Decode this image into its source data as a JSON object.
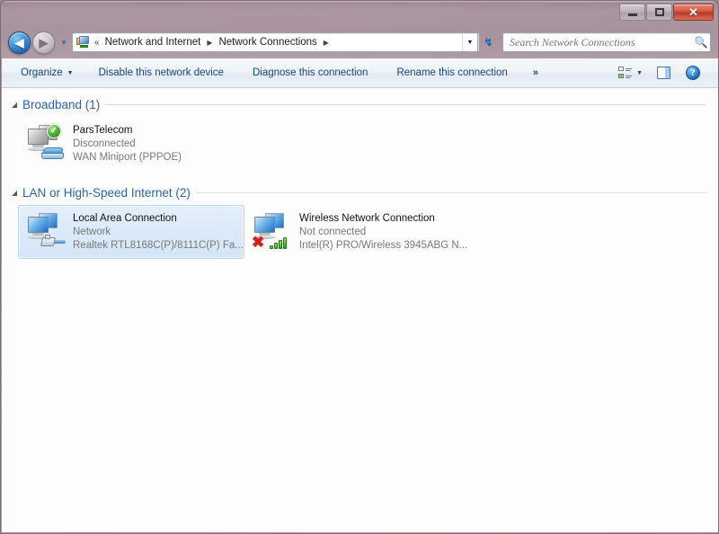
{
  "window": {
    "caption_buttons": {
      "minimize": "minimize-button",
      "maximize": "maximize-button",
      "close_label": "✕"
    }
  },
  "navigation": {
    "back_glyph": "◀",
    "forward_glyph": "▶",
    "history_glyph": "▼",
    "address_icon": "network-folder-icon",
    "overflow_crumbs": "«",
    "breadcrumbs": [
      {
        "label": "Network and Internet"
      },
      {
        "label": "Network Connections"
      }
    ],
    "crumb_arrow": "▶",
    "dropdown_glyph": "▼",
    "refresh_glyph": "↯"
  },
  "search": {
    "placeholder": "Search Network Connections",
    "value": "",
    "icon": "search-icon"
  },
  "toolbar": {
    "organize_label": "Organize",
    "organize_caret": "▼",
    "disable_label": "Disable this network device",
    "diagnose_label": "Diagnose this connection",
    "rename_label": "Rename this connection",
    "overflow_label": "»",
    "view_caret": "▼",
    "view_icon": "view-options-icon",
    "preview_icon": "preview-pane-icon",
    "help_icon": "help-icon",
    "help_glyph": "?"
  },
  "groups": [
    {
      "title": "Broadband (1)",
      "triangle": "◢",
      "items": [
        {
          "name": "ParsTelecom",
          "status": "Disconnected",
          "device": "WAN Miniport (PPPOE)",
          "icon": "broadband-connection-icon",
          "screen_state": "gray",
          "badge": "check",
          "badge_glyph": "✓",
          "overlay": "modem",
          "selected": false
        }
      ]
    },
    {
      "title": "LAN or High-Speed Internet (2)",
      "triangle": "◢",
      "items": [
        {
          "name": "Local Area Connection",
          "status": "Network",
          "device": "Realtek RTL8168C(P)/8111C(P) Fa...",
          "icon": "lan-connection-icon",
          "screen_state": "blue",
          "badge": "none",
          "badge_glyph": "",
          "overlay": "cable",
          "selected": true
        },
        {
          "name": "Wireless Network Connection",
          "status": "Not connected",
          "device": "Intel(R) PRO/Wireless 3945ABG N...",
          "icon": "wireless-connection-icon",
          "screen_state": "blue",
          "badge": "x",
          "badge_glyph": "✖",
          "overlay": "signal",
          "selected": false
        }
      ]
    }
  ],
  "colors": {
    "accent": "#2d62a8",
    "toolbar_text": "#14457e",
    "selection": "#d3e6f8",
    "status_text": "#777777",
    "close_button": "#b83a26"
  }
}
